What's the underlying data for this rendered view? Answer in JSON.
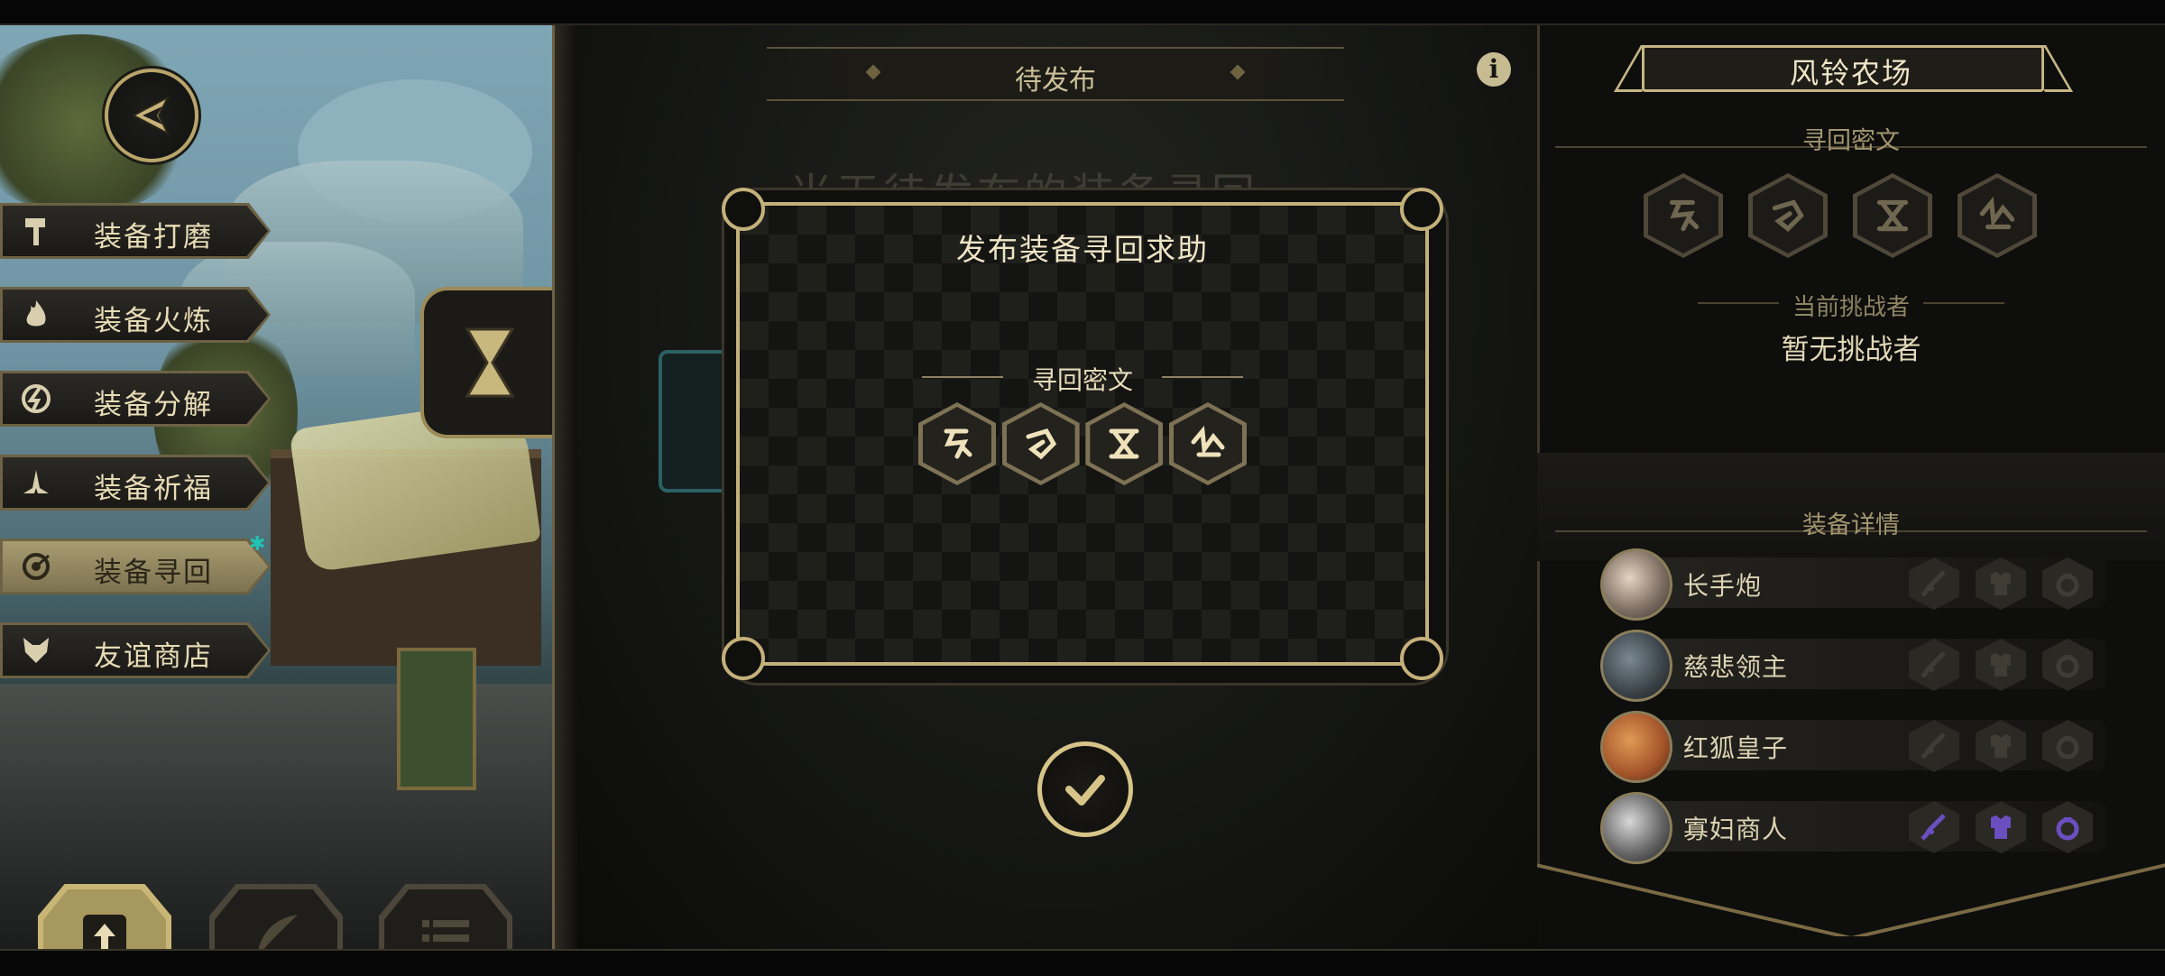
{
  "left_menu": {
    "items": [
      {
        "label": "装备打磨",
        "icon": "hammer-icon"
      },
      {
        "label": "装备火炼",
        "icon": "flame-icon"
      },
      {
        "label": "装备分解",
        "icon": "dismantle-icon"
      },
      {
        "label": "装备祈福",
        "icon": "pray-icon"
      },
      {
        "label": "装备寻回",
        "icon": "retrieve-icon",
        "active": true
      },
      {
        "label": "友谊商店",
        "icon": "fox-icon"
      }
    ],
    "notify_mark": "✱"
  },
  "bottom_tools": [
    {
      "icon": "upload-icon",
      "active": true
    },
    {
      "icon": "feather-icon",
      "active": false
    },
    {
      "icon": "list-icon",
      "active": false
    }
  ],
  "center": {
    "tab_title": "待发布",
    "background_hint": "当无待发布的装备寻回"
  },
  "dialog": {
    "title": "发布装备寻回求助",
    "cipher_header": "寻回密文",
    "runes": [
      "rune-1-icon",
      "rune-2-icon",
      "rune-3-icon",
      "rune-4-icon"
    ]
  },
  "right_panel": {
    "area_title": "风铃农场",
    "cipher_label": "寻回密文",
    "challenger_label": "当前挑战者",
    "challenger_value": "暂无挑战者",
    "equipment_label": "装备详情",
    "characters": [
      {
        "name": "长手炮",
        "slots_filled": false
      },
      {
        "name": "慈悲领主",
        "slots_filled": false
      },
      {
        "name": "红狐皇子",
        "slots_filled": false
      },
      {
        "name": "寡妇商人",
        "slots_filled": true
      }
    ]
  },
  "colors": {
    "gold": "#c5b584",
    "slot_filled": "#6b4fc0",
    "slot_empty": "#3e3c35",
    "accent_teal": "#21c2b3"
  }
}
